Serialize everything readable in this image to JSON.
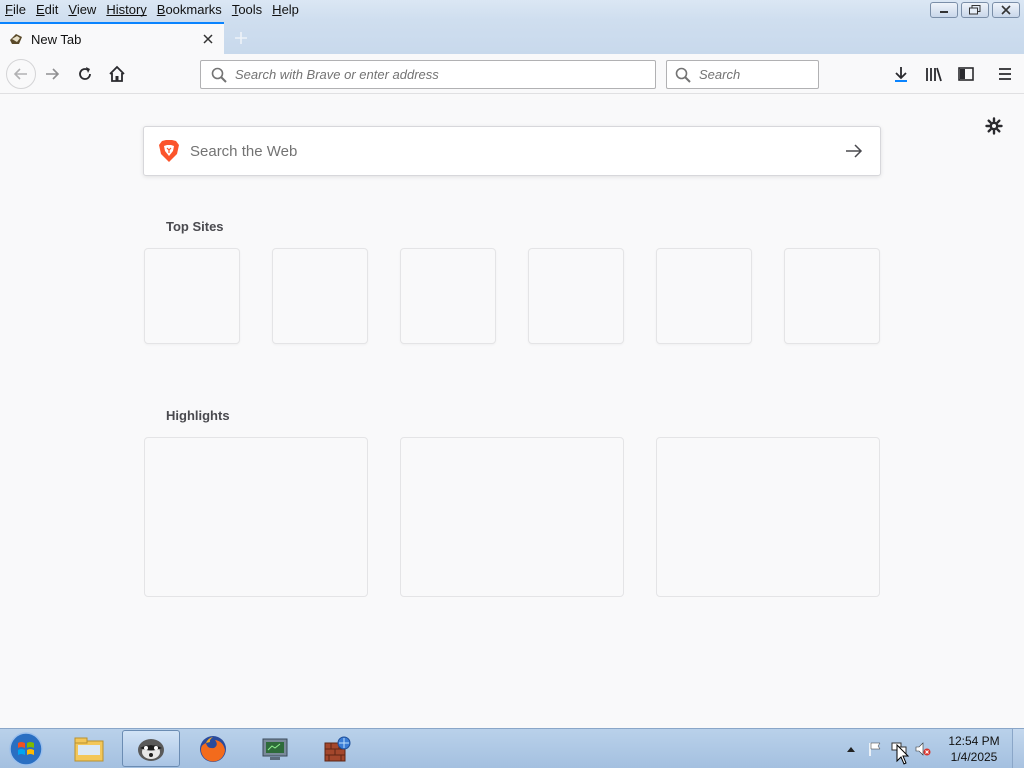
{
  "menubar": {
    "items": [
      {
        "first": "F",
        "rest": "ile"
      },
      {
        "first": "E",
        "rest": "dit"
      },
      {
        "first": "V",
        "rest": "iew"
      },
      {
        "first": "",
        "rest": "History",
        "underline": "s"
      },
      {
        "first": "B",
        "rest": "ookmarks"
      },
      {
        "first": "T",
        "rest": "ools"
      },
      {
        "first": "H",
        "rest": "elp"
      }
    ]
  },
  "tab": {
    "title": "New Tab"
  },
  "urlbar": {
    "placeholder": "Search with Brave or enter address"
  },
  "searchbar": {
    "placeholder": "Search"
  },
  "content": {
    "websearch_placeholder": "Search the Web",
    "top_sites_title": "Top Sites",
    "highlights_title": "Highlights"
  },
  "taskbar": {
    "time": "12:54 PM",
    "date": "1/4/2025"
  },
  "colors": {
    "accent": "#0a84ff",
    "brave_orange": "#fb542b"
  }
}
